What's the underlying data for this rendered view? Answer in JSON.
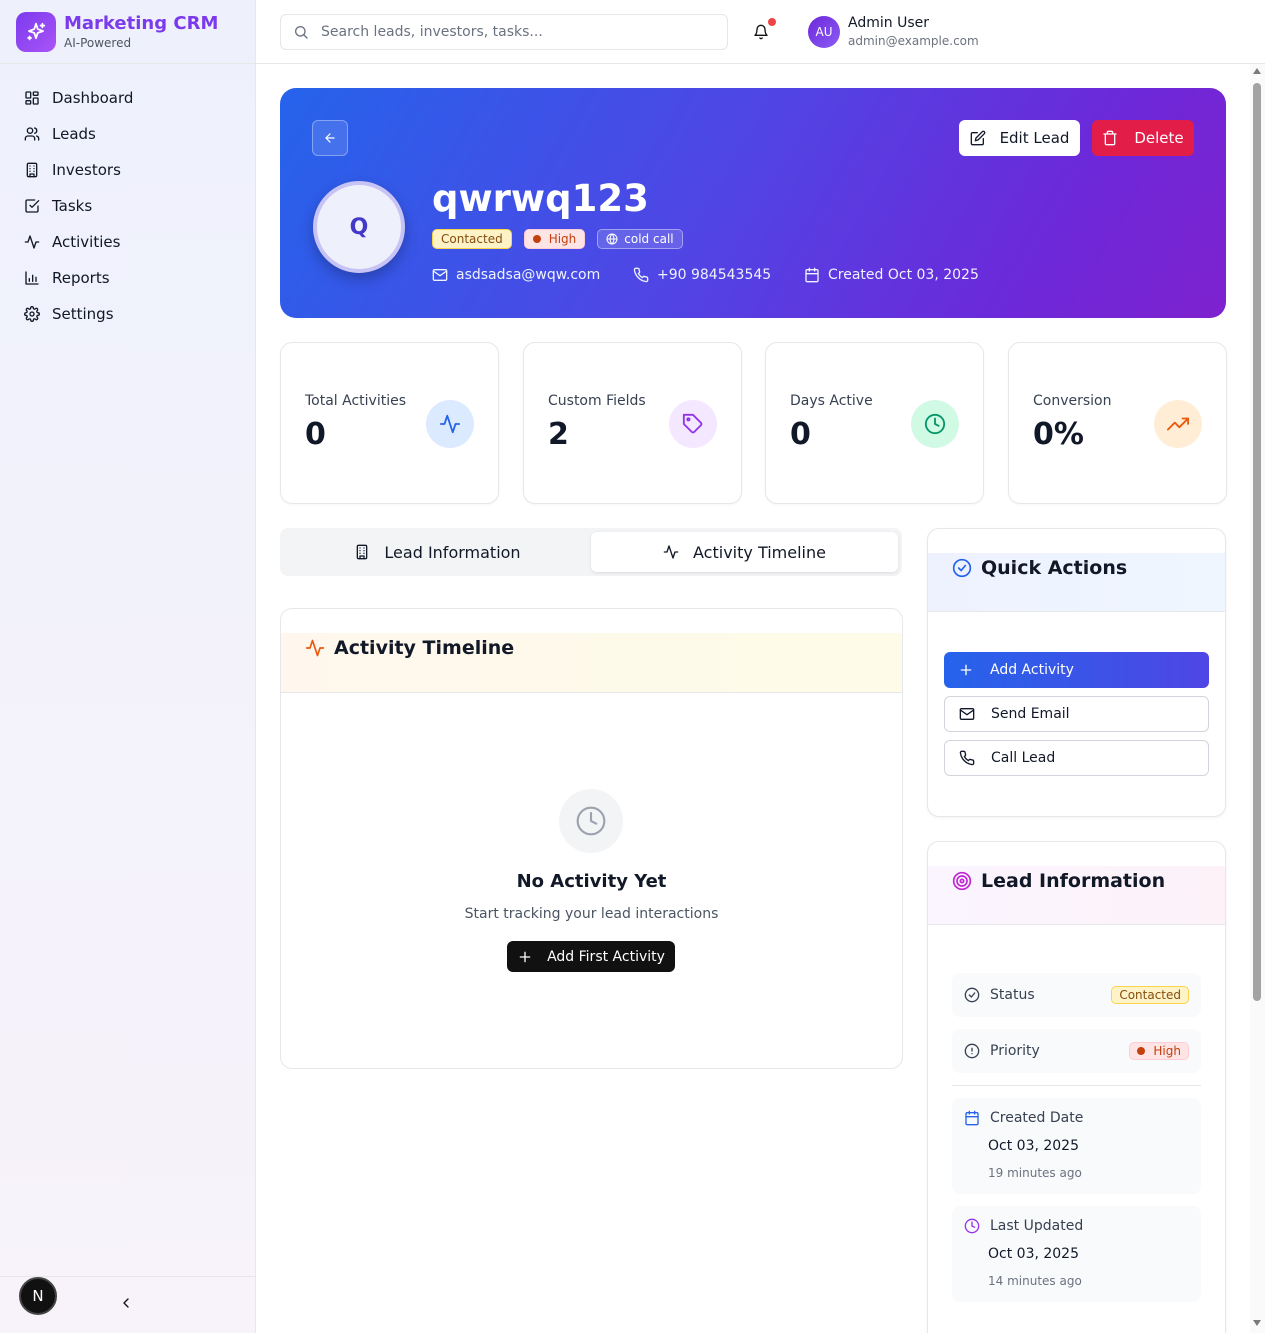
{
  "brand": {
    "name": "Marketing CRM",
    "subtitle": "AI-Powered"
  },
  "nav": [
    {
      "label": "Dashboard",
      "icon": "dashboard-icon"
    },
    {
      "label": "Leads",
      "icon": "users-icon"
    },
    {
      "label": "Investors",
      "icon": "building-icon"
    },
    {
      "label": "Tasks",
      "icon": "check-square-icon"
    },
    {
      "label": "Activities",
      "icon": "activity-icon"
    },
    {
      "label": "Reports",
      "icon": "bar-chart-icon"
    },
    {
      "label": "Settings",
      "icon": "gear-icon"
    }
  ],
  "sidebar_footer": {
    "badge": "N"
  },
  "header": {
    "search_placeholder": "Search leads, investors, tasks...",
    "user": {
      "initials": "AU",
      "name": "Admin User",
      "email": "admin@example.com"
    }
  },
  "lead": {
    "initial": "Q",
    "name": "qwrwq123",
    "status": "Contacted",
    "priority": "High",
    "source": "cold call",
    "email": "asdsadsa@wqw.com",
    "phone": "+90 984543545",
    "created": "Created Oct 03, 2025",
    "edit_label": "Edit Lead",
    "delete_label": "Delete"
  },
  "stats": [
    {
      "label": "Total Activities",
      "value": "0",
      "icon": "activity-icon",
      "color": "#2563eb",
      "bg": "#dbeafe"
    },
    {
      "label": "Custom Fields",
      "value": "2",
      "icon": "tag-icon",
      "color": "#9333ea",
      "bg": "#f3e8ff"
    },
    {
      "label": "Days Active",
      "value": "0",
      "icon": "clock-icon",
      "color": "#059669",
      "bg": "#d1fae5"
    },
    {
      "label": "Conversion",
      "value": "0%",
      "icon": "trending-up-icon",
      "color": "#ea580c",
      "bg": "#ffedd5"
    }
  ],
  "tabs": [
    {
      "label": "Lead Information",
      "active": false
    },
    {
      "label": "Activity Timeline",
      "active": true
    }
  ],
  "timeline": {
    "title": "Activity Timeline",
    "empty_title": "No Activity Yet",
    "empty_subtitle": "Start tracking your lead interactions",
    "add_first_label": "Add First Activity"
  },
  "quick_actions": {
    "title": "Quick Actions",
    "add_activity": "Add Activity",
    "send_email": "Send Email",
    "call_lead": "Call Lead"
  },
  "lead_info": {
    "title": "Lead Information",
    "status_label": "Status",
    "status_value": "Contacted",
    "priority_label": "Priority",
    "priority_value": "High",
    "created_label": "Created Date",
    "created_value": "Oct 03, 2025",
    "created_ago": "19 minutes ago",
    "updated_label": "Last Updated",
    "updated_value": "Oct 03, 2025",
    "updated_ago": "14 minutes ago"
  },
  "colors": {
    "brand": "#7c3aed",
    "hero_start": "#2563eb",
    "hero_end": "#7e22ce",
    "delete": "#e11d48",
    "notification_dot": "#ef4444"
  }
}
